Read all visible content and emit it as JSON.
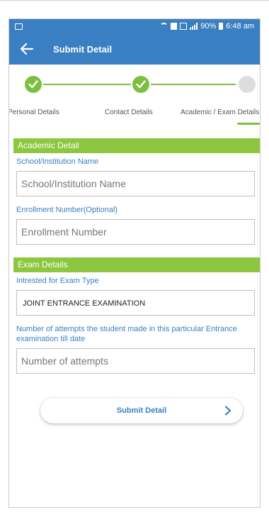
{
  "status_bar": {
    "battery": "90%",
    "time": "6:48 am",
    "icons": [
      "image-icon",
      "wifi-icon",
      "data-icon",
      "sim-icon",
      "signal-icon",
      "battery-icon"
    ]
  },
  "app_bar": {
    "title": "Submit Detail",
    "back_icon": "arrow-left-icon"
  },
  "stepper": {
    "steps": [
      {
        "label": "Personal Details",
        "status": "done"
      },
      {
        "label": "Contact Details",
        "status": "done"
      },
      {
        "label": "Academic / Exam Details",
        "status": "current"
      }
    ],
    "accent": "#7cbf3f"
  },
  "academic": {
    "header": "Academic Detail",
    "school_label": "School/Institution Name",
    "school_placeholder": "School/Institution Name",
    "enrollment_label": "Enrollment Number(Optional)",
    "enrollment_placeholder": "Enrollment Number"
  },
  "exam": {
    "header": "Exam Details",
    "type_label": "Intrested for Exam Type",
    "type_value": "JOINT ENTRANCE EXAMINATION",
    "attempts_label": "Number of attempts the student made in this particular Entrance examination till date",
    "attempts_placeholder": "Number of attempts"
  },
  "submit": {
    "label": "Submit Detail"
  },
  "colors": {
    "primary": "#3a7fc1",
    "accent_green": "#8dc63f",
    "pending_grey": "#dddddd"
  }
}
